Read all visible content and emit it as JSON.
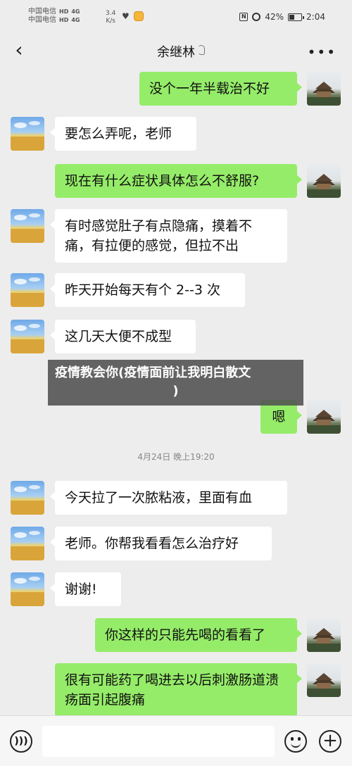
{
  "status_bar": {
    "carrier_1": "中国电信",
    "carrier_2": "中国电信",
    "hd": "HD",
    "net_1": "4G",
    "net_2": "4G",
    "speed_value": "3.4",
    "speed_unit": "K/s",
    "battery_percent": "42%",
    "battery_level": 0.42,
    "time": "2:04"
  },
  "nav": {
    "title": "余继林"
  },
  "icons": {
    "back": "chevron-left-icon",
    "ear": "ear-icon",
    "more": "more-icon",
    "voice": "voice-icon",
    "emoji": "emoji-icon",
    "plus": "plus-icon"
  },
  "messages": [
    {
      "side": "out",
      "text": "没个一年半载治不好"
    },
    {
      "side": "in",
      "text": "要怎么弄呢，老师"
    },
    {
      "side": "out",
      "text": "现在有什么症状具体怎么不舒服?"
    },
    {
      "side": "in",
      "text": "有时感觉肚子有点隐痛，摸着不痛，有拉便的感觉，但拉不出"
    },
    {
      "side": "in",
      "text": "昨天开始每天有个 2--3 次"
    },
    {
      "side": "in",
      "text": "这几天大便不成型"
    },
    {
      "side": "out",
      "text": "嗯"
    },
    {
      "side": "in",
      "text": "今天拉了一次脓粘液，里面有血"
    },
    {
      "side": "in",
      "text": "老师。你帮我看看怎么治疗好"
    },
    {
      "side": "in",
      "text": "谢谢!"
    },
    {
      "side": "out",
      "text": "你这样的只能先喝的看看了"
    },
    {
      "side": "out",
      "text": "很有可能药了喝进去以后刺激肠道溃疡面引起腹痛"
    }
  ],
  "timestamp": "4月24日 晚上19:20",
  "overlay": {
    "line1": "疫情教会你(疫情面前让我明白散文",
    "line2": ")"
  },
  "colors": {
    "background": "#ededed",
    "bubble_out": "#95ec69",
    "bubble_in": "#ffffff"
  }
}
